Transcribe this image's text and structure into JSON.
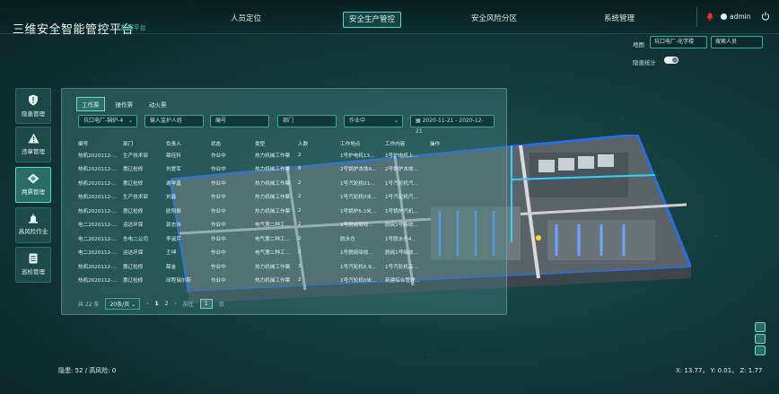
{
  "app": {
    "title": "三维安全智能管控平台",
    "subtitle": "\\ 数据平台"
  },
  "nav": [
    {
      "label": "人员定位"
    },
    {
      "label": "安全生产管控"
    },
    {
      "label": "安全风险分区"
    },
    {
      "label": "系统管理"
    }
  ],
  "user": {
    "name": "admin"
  },
  "map_select": {
    "label": "地图",
    "value": "坑口电厂-化学楼",
    "search_placeholder": "搜索人员"
  },
  "hazard_stats": {
    "label": "隐患统计"
  },
  "sidebar": [
    {
      "label": "隐患管理",
      "icon": "shield-alert-icon"
    },
    {
      "label": "违章管理",
      "icon": "warning-triangle-icon"
    },
    {
      "label": "两票管理",
      "icon": "ticket-icon"
    },
    {
      "label": "高风险作业",
      "icon": "alarm-light-icon"
    },
    {
      "label": "巡检管理",
      "icon": "inspection-list-icon"
    }
  ],
  "panel": {
    "tabs": [
      "工作票",
      "操作票",
      "动火票"
    ],
    "filters": {
      "unit": "坑口电厂-锅炉-4",
      "guardian_placeholder": "输入监护人姓",
      "number_placeholder": "编号",
      "dept_placeholder": "部门",
      "status": "作业中",
      "date_range": "2020-11-21 - 2020-12-21"
    },
    "columns": [
      "编号",
      "部门",
      "负责人",
      "状态",
      "类型",
      "人数",
      "工作地点",
      "工作内容",
      "操作"
    ],
    "rows": [
      [
        "热机2020112-...",
        "生产技术部",
        "薛佳科",
        "作业中",
        "热力机械工作票",
        "2",
        "1号炉电机13...",
        "1号炉电机上..."
      ],
      [
        "热机2020112-...",
        "惠辽检修",
        "刘爱军",
        "作业中",
        "热力机械工作票",
        "8",
        "2号锅炉本体A...",
        "2号锅炉本体..."
      ],
      [
        "热机2020112-...",
        "惠辽检修",
        "谢学鑫",
        "作业中",
        "热力机械工作票",
        "2",
        "1号汽轮机01...",
        "1号汽轮机汽..."
      ],
      [
        "热机2020112-...",
        "生产技术部",
        "刘鑫",
        "作业中",
        "热力机械工作票",
        "2",
        "1号汽轮机0米...",
        "1号汽轮机汽..."
      ],
      [
        "热机2020112-...",
        "惠辽检修",
        "欧阳振",
        "作业中",
        "热力机械工作票",
        "2",
        "1号锅炉6.3米...",
        "1号锅炉汽机..."
      ],
      [
        "电二2020112-...",
        "运达环保",
        "郭志伟",
        "作业中",
        "电气第二种工...",
        "2",
        "1号脱硫吸收...",
        "脱硫1号吸收..."
      ],
      [
        "电二2020112-...",
        "东电二公司",
        "李淑芹",
        "作业中",
        "电气第二种工...",
        "2",
        "脱水仓",
        "1号脱水仓4..."
      ],
      [
        "电二2020112-...",
        "运达环保",
        "王坤",
        "作业中",
        "电气第二种工...",
        "2",
        "1号脱硫吸收...",
        "脱硫1号吸收..."
      ],
      [
        "热机2020112-...",
        "惠辽检修",
        "薛金",
        "作业中",
        "热力机械工作票",
        "3",
        "1号汽轮机6.9...",
        "1号汽轮机高..."
      ],
      [
        "热机2020112-...",
        "惠辽检修",
        "邱程瑞尔斯",
        "作业中",
        "热力机械工作票",
        "2",
        "1号汽轮机0米...",
        "新建综合管理..."
      ]
    ],
    "pagination": {
      "total": "共 22 条",
      "page_size": "20条/页",
      "pages": [
        "1",
        "2"
      ],
      "goto_label": "前往",
      "goto_value": "1",
      "goto_suffix": "页"
    }
  },
  "footer": {
    "stats": "隐患: 52 / 高风险: 0",
    "coords": "X: 13.77， Y: 0.01， Z: 1.77"
  },
  "colors": {
    "accent": "#4fd9bd",
    "bg": "#123a3b",
    "danger": "#ff3030"
  }
}
